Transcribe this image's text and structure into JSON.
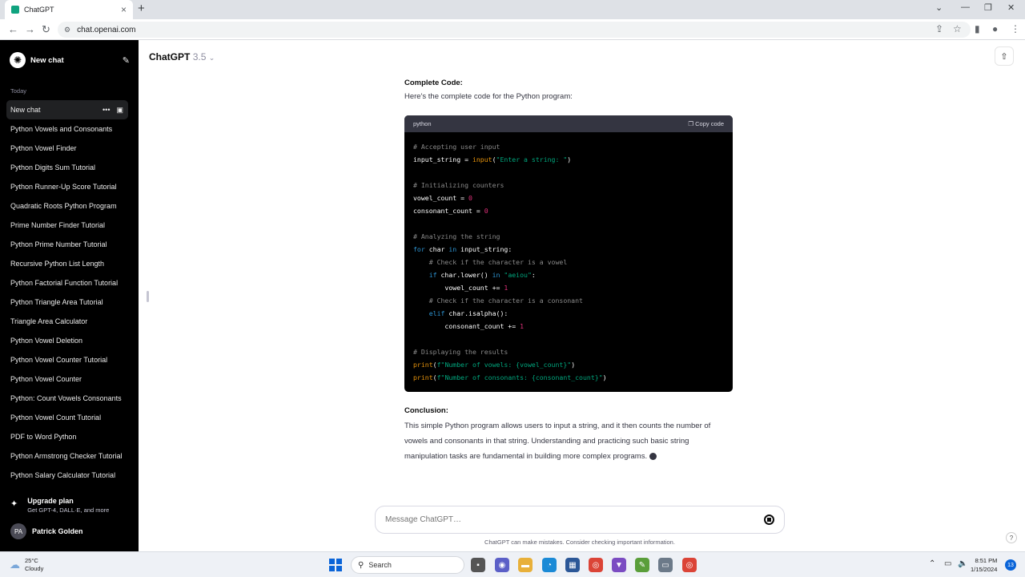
{
  "browser": {
    "tab_title": "ChatGPT",
    "url": "chat.openai.com"
  },
  "sidebar": {
    "new_chat": "New chat",
    "section_label": "Today",
    "active_chat": "New chat",
    "chats": [
      "Python Vowels and Consonants",
      "Python Vowel Finder",
      "Python Digits Sum Tutorial",
      "Python Runner-Up Score Tutorial",
      "Quadratic Roots Python Program",
      "Prime Number Finder Tutorial",
      "Python Prime Number Tutorial",
      "Recursive Python List Length",
      "Python Factorial Function Tutorial",
      "Python Triangle Area Tutorial",
      "Triangle Area Calculator",
      "Python Vowel Deletion",
      "Python Vowel Counter Tutorial",
      "Python Vowel Counter",
      "Python: Count Vowels Consonants",
      "Python Vowel Count Tutorial",
      "PDF to Word Python",
      "Python Armstrong Checker Tutorial",
      "Python Salary Calculator Tutorial"
    ],
    "upgrade_title": "Upgrade plan",
    "upgrade_sub": "Get GPT-4, DALL·E, and more",
    "user_initials": "PA",
    "user_name": "Patrick Golden"
  },
  "header": {
    "model_name": "ChatGPT",
    "model_version": "3.5"
  },
  "message": {
    "heading": "Complete Code:",
    "intro": "Here's the complete code for the Python program:",
    "code_lang": "python",
    "copy_label": "Copy code",
    "code_lines": [
      [
        [
          "cm",
          "# Accepting user input"
        ]
      ],
      [
        [
          "",
          "input_string = "
        ],
        [
          "fn",
          "input"
        ],
        [
          "",
          "("
        ],
        [
          "st",
          "\"Enter a string: \""
        ],
        [
          "",
          ")"
        ]
      ],
      [],
      [
        [
          "cm",
          "# Initializing counters"
        ]
      ],
      [
        [
          "",
          "vowel_count = "
        ],
        [
          "nm",
          "0"
        ]
      ],
      [
        [
          "",
          "consonant_count = "
        ],
        [
          "nm",
          "0"
        ]
      ],
      [],
      [
        [
          "cm",
          "# Analyzing the string"
        ]
      ],
      [
        [
          "kw",
          "for"
        ],
        [
          "",
          " char "
        ],
        [
          "kw",
          "in"
        ],
        [
          "",
          " input_string:"
        ]
      ],
      [
        [
          "",
          "    "
        ],
        [
          "cm",
          "# Check if the character is a vowel"
        ]
      ],
      [
        [
          "",
          "    "
        ],
        [
          "kw",
          "if"
        ],
        [
          "",
          " char.lower() "
        ],
        [
          "kw",
          "in"
        ],
        [
          "",
          " "
        ],
        [
          "st",
          "\"aeiou\""
        ],
        [
          "",
          ":"
        ]
      ],
      [
        [
          "",
          "        vowel_count += "
        ],
        [
          "nm",
          "1"
        ]
      ],
      [
        [
          "",
          "    "
        ],
        [
          "cm",
          "# Check if the character is a consonant"
        ]
      ],
      [
        [
          "",
          "    "
        ],
        [
          "kw",
          "elif"
        ],
        [
          "",
          " char.isalpha():"
        ]
      ],
      [
        [
          "",
          "        consonant_count += "
        ],
        [
          "nm",
          "1"
        ]
      ],
      [],
      [
        [
          "cm",
          "# Displaying the results"
        ]
      ],
      [
        [
          "fn",
          "print"
        ],
        [
          "",
          "("
        ],
        [
          "st",
          "f\"Number of vowels: {vowel_count}\""
        ],
        [
          "",
          ")"
        ]
      ],
      [
        [
          "fn",
          "print"
        ],
        [
          "",
          "("
        ],
        [
          "st",
          "f\"Number of consonants: {consonant_count}\""
        ],
        [
          "",
          ")"
        ]
      ]
    ],
    "conclusion_heading": "Conclusion:",
    "conclusion_text": "This simple Python program allows users to input a string, and it then counts the number of vowels and consonants in that string. Understanding and practicing such basic string manipulation tasks are fundamental in building more complex programs."
  },
  "composer": {
    "placeholder": "Message ChatGPT…",
    "disclaimer": "ChatGPT can make mistakes. Consider checking important information."
  },
  "taskbar": {
    "temp": "25°C",
    "condition": "Cloudy",
    "search_label": "Search",
    "time": "8:51 PM",
    "date": "1/15/2024",
    "notifications": "13"
  },
  "colors": {
    "sidebar_bg": "#000000",
    "code_header_bg": "#343541",
    "keyword": "#2e95d3",
    "string": "#00a67d",
    "number": "#df3079",
    "function": "#e9950c",
    "comment": "#8a8a8a"
  }
}
